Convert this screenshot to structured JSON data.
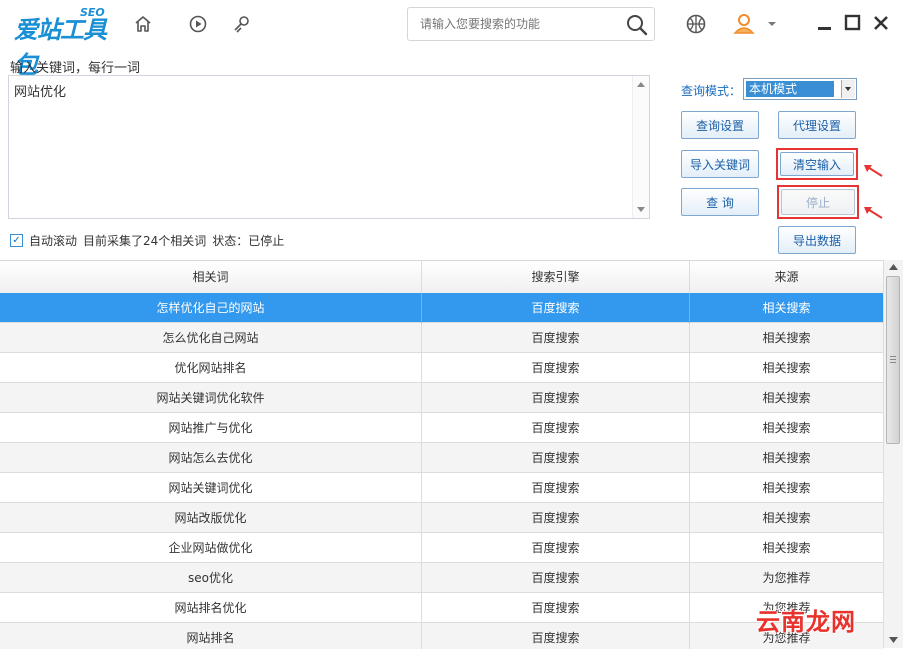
{
  "app": {
    "logo_text": "爱站工具包",
    "logo_badge": "SEO",
    "search_placeholder": "请输入您要搜索的功能"
  },
  "icons": {
    "home": "home-icon",
    "play": "play-icon",
    "tools": "tools-icon",
    "search": "search-icon",
    "basketball": "basketball-icon",
    "user": "user-icon",
    "dropdown": "chevron-down-icon",
    "minimize": "minimize-icon",
    "maximize": "maximize-icon",
    "close": "close-icon"
  },
  "colors": {
    "accent": "#1a8fd6",
    "selected_row": "#3399ee",
    "highlight_border": "#e63333",
    "watermark": "#e8322b"
  },
  "input": {
    "label": "输入关键词，每行一词",
    "value": "网站优化"
  },
  "status": {
    "auto_scroll_label": "自动滚动",
    "auto_scroll_checked": true,
    "collected_text": "目前采集了24个相关词",
    "state_text": "状态：已停止"
  },
  "controls": {
    "mode_label": "查询模式：",
    "mode_value": "本机模式",
    "query_settings": "查询设置",
    "proxy_settings": "代理设置",
    "import_keywords": "导入关键词",
    "clear_input": "清空输入",
    "query": "查  询",
    "stop": "停止",
    "export_data": "导出数据"
  },
  "table": {
    "headers": [
      "相关词",
      "搜索引擎",
      "来源"
    ],
    "rows": [
      [
        "怎样优化自己的网站",
        "百度搜索",
        "相关搜索"
      ],
      [
        "怎么优化自己网站",
        "百度搜索",
        "相关搜索"
      ],
      [
        "优化网站排名",
        "百度搜索",
        "相关搜索"
      ],
      [
        "网站关键词优化软件",
        "百度搜索",
        "相关搜索"
      ],
      [
        "网站推广与优化",
        "百度搜索",
        "相关搜索"
      ],
      [
        "网站怎么去优化",
        "百度搜索",
        "相关搜索"
      ],
      [
        "网站关键词优化",
        "百度搜索",
        "相关搜索"
      ],
      [
        "网站改版优化",
        "百度搜索",
        "相关搜索"
      ],
      [
        "企业网站做优化",
        "百度搜索",
        "相关搜索"
      ],
      [
        "seo优化",
        "百度搜索",
        "为您推荐"
      ],
      [
        "网站排名优化",
        "百度搜索",
        "为您推荐"
      ],
      [
        "网站排名",
        "百度搜索",
        "为您推荐"
      ]
    ],
    "selected_index": 0
  },
  "watermark": "云南龙网"
}
